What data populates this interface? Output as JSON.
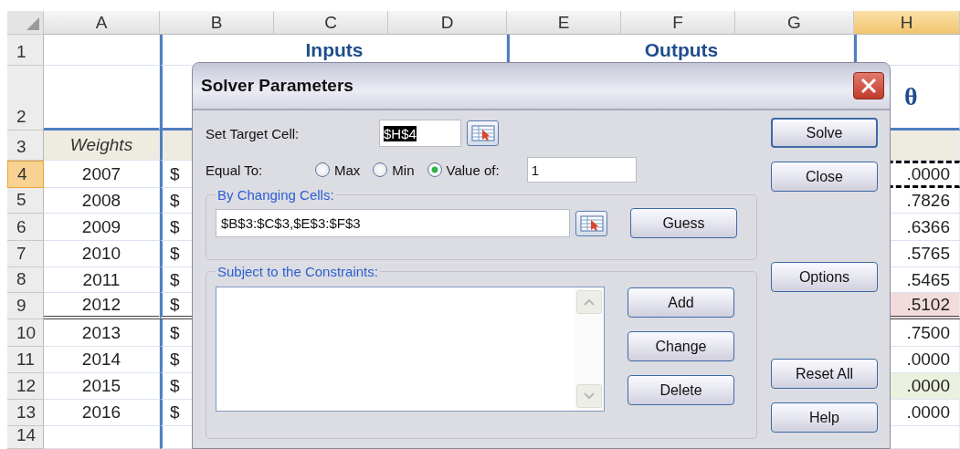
{
  "sheet": {
    "columns": [
      {
        "label": "A",
        "selected": false
      },
      {
        "label": "B",
        "selected": false
      },
      {
        "label": "C",
        "selected": false
      },
      {
        "label": "D",
        "selected": false
      },
      {
        "label": "E",
        "selected": false
      },
      {
        "label": "F",
        "selected": false
      },
      {
        "label": "G",
        "selected": false
      },
      {
        "label": "H",
        "selected": true
      }
    ],
    "row_numbers": [
      {
        "label": "1",
        "selected": false
      },
      {
        "label": "2",
        "selected": false
      },
      {
        "label": "3",
        "selected": false
      },
      {
        "label": "4",
        "selected": true
      },
      {
        "label": "5",
        "selected": false
      },
      {
        "label": "6",
        "selected": false
      },
      {
        "label": "7",
        "selected": false
      },
      {
        "label": "8",
        "selected": false
      },
      {
        "label": "9",
        "selected": false
      },
      {
        "label": "10",
        "selected": false
      },
      {
        "label": "11",
        "selected": false
      },
      {
        "label": "12",
        "selected": false
      },
      {
        "label": "13",
        "selected": false
      },
      {
        "label": "14",
        "selected": false
      }
    ],
    "inputs_heading": "Inputs",
    "outputs_heading": "Outputs",
    "theta_heading": "θ",
    "weights_label": "Weights",
    "rows": [
      {
        "year": "2007",
        "currency": "$",
        "output": ".0000",
        "kind": "copied"
      },
      {
        "year": "2008",
        "currency": "$",
        "output": ".7826",
        "kind": "plain"
      },
      {
        "year": "2009",
        "currency": "$",
        "output": ".6366",
        "kind": "plain"
      },
      {
        "year": "2010",
        "currency": "$",
        "output": ".5765",
        "kind": "plain"
      },
      {
        "year": "2011",
        "currency": "$",
        "output": ".5465",
        "kind": "plain"
      },
      {
        "year": "2012",
        "currency": "$",
        "output": ".5102",
        "kind": "bad"
      },
      {
        "year": "2013",
        "currency": "$",
        "output": ".7500",
        "kind": "plain"
      },
      {
        "year": "2014",
        "currency": "$",
        "output": ".0000",
        "kind": "plain"
      },
      {
        "year": "2015",
        "currency": "$",
        "output": ".0000",
        "kind": "good"
      },
      {
        "year": "2016",
        "currency": "$",
        "output": ".0000",
        "kind": "plain"
      }
    ]
  },
  "dialog": {
    "title": "Solver Parameters",
    "target": {
      "label": "Set Target Cell:",
      "value": "$H$4",
      "text_selected": true
    },
    "equal_to": {
      "label": "Equal To:",
      "options": [
        {
          "label": "Max",
          "selected": false
        },
        {
          "label": "Min",
          "selected": false
        },
        {
          "label": "Value of:",
          "selected": true
        }
      ],
      "value": "1"
    },
    "changing": {
      "legend": "By Changing Cells:",
      "value": "$B$3:$C$3,$E$3:$F$3",
      "button": "Guess"
    },
    "constraints": {
      "legend": "Subject to the Constraints:",
      "buttons": [
        "Add",
        "Change",
        "Delete"
      ]
    },
    "side_groups": [
      [
        "Solve",
        "Close"
      ],
      [
        "Options"
      ],
      [
        "Reset All",
        "Help"
      ]
    ]
  }
}
